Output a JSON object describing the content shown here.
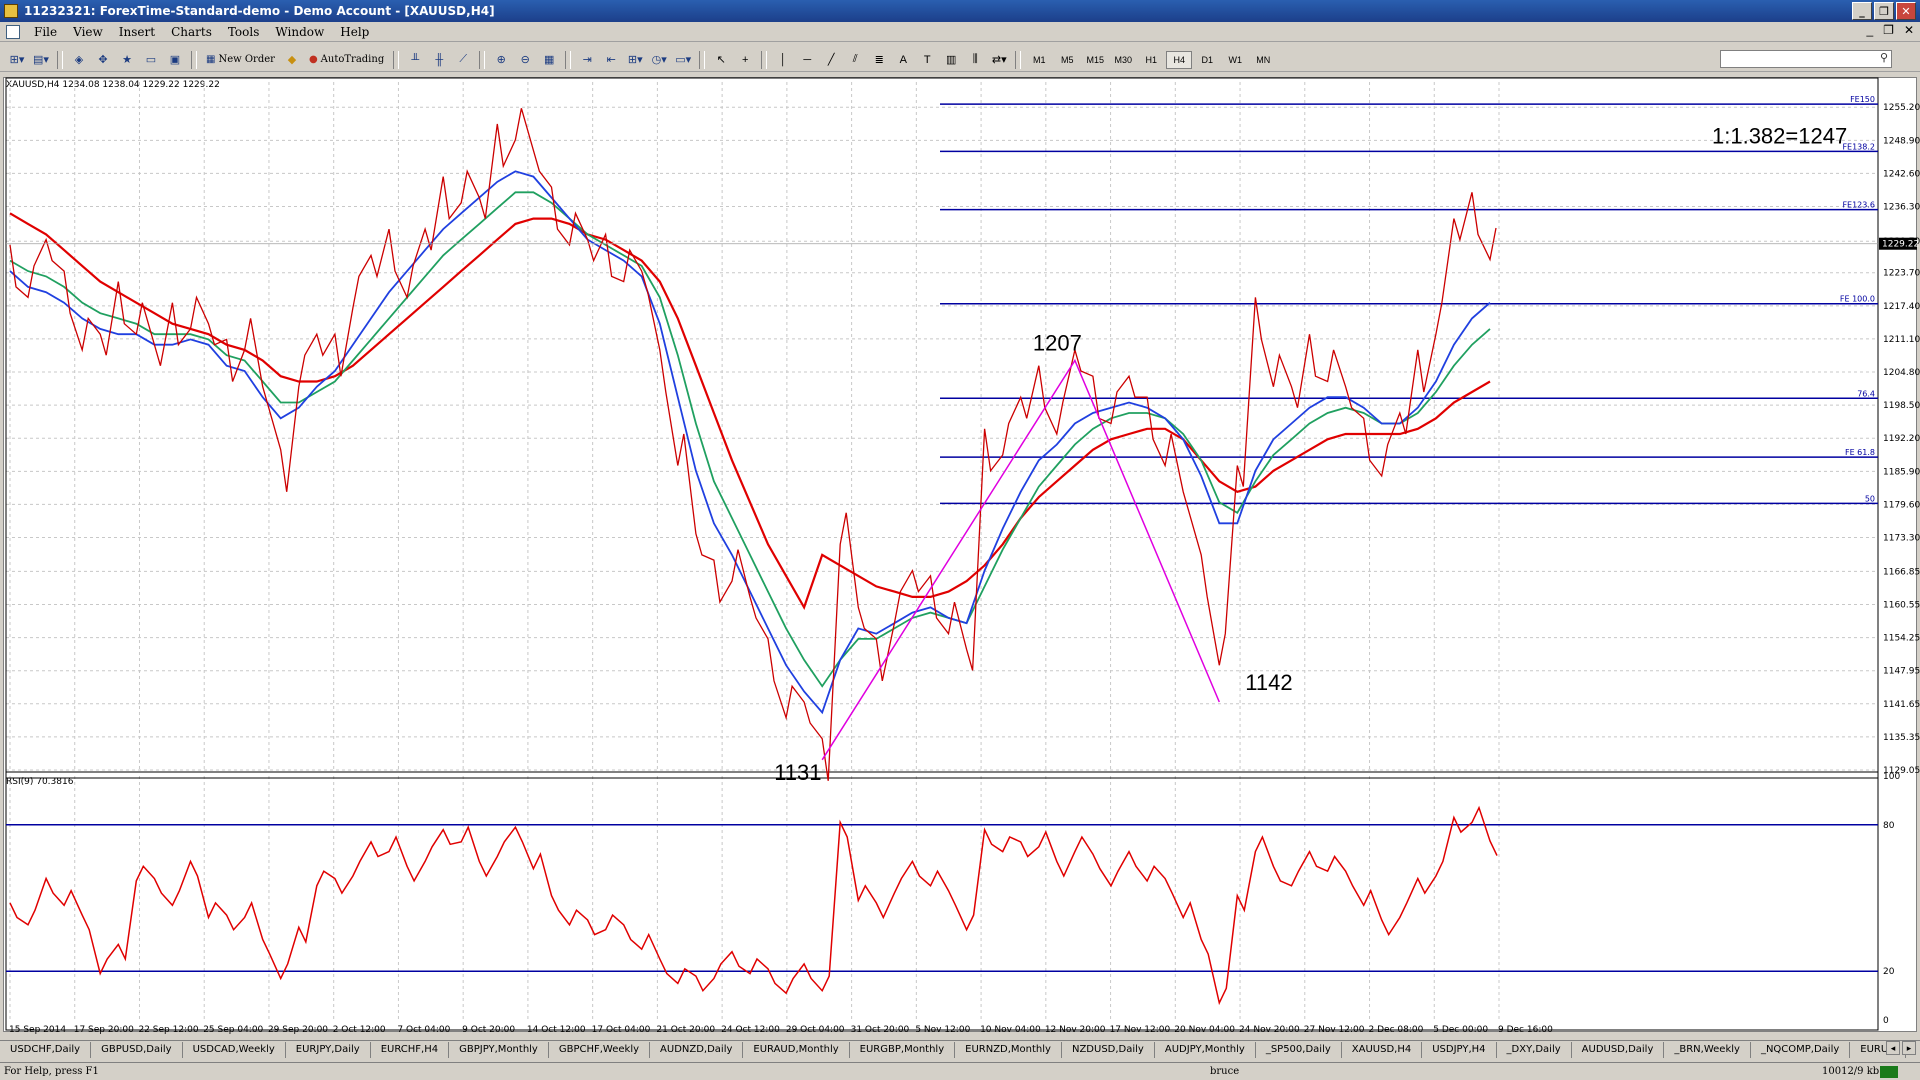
{
  "window": {
    "title": "11232321: ForexTime-Standard-demo - Demo Account - [XAUUSD,H4]",
    "controls": [
      "_",
      "❐",
      "✕"
    ]
  },
  "menu": {
    "items": [
      "File",
      "View",
      "Insert",
      "Charts",
      "Tools",
      "Window",
      "Help"
    ],
    "mdi_controls": [
      "_",
      "❐",
      "✕"
    ]
  },
  "toolbar": {
    "new_order_label": "New Order",
    "autotrading_label": "AutoTrading",
    "timeframes": [
      "M1",
      "M5",
      "M15",
      "M30",
      "H1",
      "H4",
      "D1",
      "W1",
      "MN"
    ],
    "active_timeframe": "H4",
    "search_placeholder": ""
  },
  "chart": {
    "header": "XAUUSD,H4  1234.08 1238.04 1229.22 1229.22",
    "rsi_header": "RSI(9) 70.3816",
    "current_price_label": "1229.22"
  },
  "chart_data": [
    {
      "type": "line",
      "title": "XAUUSD,H4  1234.08 1238.04 1229.22 1229.22",
      "x_ticks": [
        "15 Sep 2014",
        "17 Sep 20:00",
        "22 Sep 12:00",
        "25 Sep 04:00",
        "29 Sep 20:00",
        "2 Oct 12:00",
        "7 Oct 04:00",
        "9 Oct 20:00",
        "14 Oct 12:00",
        "17 Oct 04:00",
        "21 Oct 20:00",
        "24 Oct 12:00",
        "29 Oct 04:00",
        "31 Oct 20:00",
        "5 Nov 12:00",
        "10 Nov 04:00",
        "12 Nov 20:00",
        "17 Nov 12:00",
        "20 Nov 04:00",
        "24 Nov 20:00",
        "27 Nov 12:00",
        "2 Dec 08:00",
        "5 Dec 00:00",
        "9 Dec 16:00"
      ],
      "y_ticks": [
        "1255.20",
        "1248.90",
        "1242.60",
        "1236.30",
        "1229.70",
        "1223.70",
        "1217.40",
        "1211.10",
        "1204.80",
        "1198.50",
        "1192.20",
        "1185.90",
        "1179.60",
        "1173.30",
        "1166.85",
        "1160.55",
        "1154.25",
        "1147.95",
        "1141.65",
        "1135.35",
        "1129.05"
      ],
      "ylim": [
        1129.05,
        1260
      ],
      "price_path": [
        1225,
        1222,
        1228,
        1220,
        1212,
        1210,
        1218,
        1215,
        1208,
        1214,
        1216,
        1212,
        1207,
        1212,
        1200,
        1186,
        1205,
        1210,
        1208,
        1220,
        1225,
        1228,
        1222,
        1230,
        1238,
        1240,
        1236,
        1248,
        1252,
        1245,
        1236,
        1232,
        1228,
        1227,
        1225,
        1222,
        1205,
        1190,
        1172,
        1165,
        1168,
        1160,
        1150,
        1142,
        1140,
        1131,
        1175,
        1158,
        1150,
        1160,
        1165,
        1162,
        1158,
        1150,
        1190,
        1192,
        1198,
        1202,
        1196,
        1207,
        1200,
        1198,
        1202,
        1196,
        1190,
        1180,
        1166,
        1152,
        1185,
        1215,
        1205,
        1200,
        1208,
        1206,
        1200,
        1192,
        1188,
        1195,
        1205,
        1215,
        1232,
        1235,
        1229.22
      ],
      "ma_fast_path": [
        1224,
        1221,
        1220,
        1218,
        1215,
        1213,
        1212,
        1212,
        1210,
        1210,
        1211,
        1210,
        1206,
        1205,
        1200,
        1196,
        1198,
        1202,
        1205,
        1210,
        1215,
        1220,
        1224,
        1228,
        1232,
        1235,
        1238,
        1241,
        1243,
        1242,
        1238,
        1234,
        1230,
        1228,
        1226,
        1223,
        1214,
        1200,
        1186,
        1176,
        1170,
        1163,
        1156,
        1149,
        1144,
        1140,
        1150,
        1156,
        1155,
        1157,
        1159,
        1160,
        1158,
        1157,
        1167,
        1175,
        1182,
        1188,
        1191,
        1195,
        1197,
        1198,
        1199,
        1198,
        1196,
        1192,
        1185,
        1176,
        1176,
        1186,
        1192,
        1195,
        1198,
        1200,
        1200,
        1198,
        1195,
        1195,
        1198,
        1203,
        1210,
        1215,
        1218
      ],
      "ma_mid_path": [
        1226,
        1224,
        1223,
        1221,
        1218,
        1216,
        1215,
        1214,
        1212,
        1212,
        1212,
        1211,
        1208,
        1207,
        1203,
        1199,
        1199,
        1201,
        1203,
        1207,
        1211,
        1215,
        1219,
        1223,
        1227,
        1230,
        1233,
        1236,
        1239,
        1239,
        1237,
        1234,
        1231,
        1229,
        1227,
        1225,
        1219,
        1208,
        1195,
        1184,
        1177,
        1170,
        1163,
        1156,
        1150,
        1145,
        1150,
        1154,
        1154,
        1156,
        1158,
        1159,
        1158,
        1157,
        1164,
        1171,
        1177,
        1183,
        1187,
        1191,
        1194,
        1196,
        1197,
        1197,
        1196,
        1193,
        1188,
        1180,
        1178,
        1184,
        1189,
        1192,
        1195,
        1197,
        1198,
        1197,
        1195,
        1195,
        1197,
        1201,
        1206,
        1210,
        1213
      ],
      "ma_slow_path": [
        1235,
        1233,
        1231,
        1228,
        1225,
        1222,
        1220,
        1218,
        1216,
        1214,
        1213,
        1212,
        1210,
        1209,
        1207,
        1204,
        1203,
        1203,
        1204,
        1206,
        1209,
        1212,
        1215,
        1218,
        1221,
        1224,
        1227,
        1230,
        1233,
        1234,
        1234,
        1233,
        1231,
        1230,
        1228,
        1226,
        1222,
        1215,
        1206,
        1197,
        1188,
        1180,
        1172,
        1166,
        1160,
        1170,
        1168,
        1166,
        1164,
        1163,
        1162,
        1162,
        1163,
        1165,
        1168,
        1172,
        1177,
        1181,
        1184,
        1187,
        1190,
        1192,
        1193,
        1194,
        1194,
        1192,
        1188,
        1184,
        1182,
        1183,
        1186,
        1188,
        1190,
        1192,
        1193,
        1193,
        1193,
        1193,
        1194,
        1196,
        1199,
        1201,
        1203
      ],
      "fibo_levels": [
        {
          "label": "FE150",
          "value": 1255.8
        },
        {
          "label": "FE138.2",
          "value": 1246.8
        },
        {
          "label": "FE123.6",
          "value": 1235.7
        },
        {
          "label": "FE 100.0",
          "value": 1217.8
        },
        {
          "label": "76.4",
          "value": 1199.8
        },
        {
          "label": "FE 61.8",
          "value": 1188.6
        },
        {
          "label": "50",
          "value": 1179.8
        }
      ],
      "swing_points": [
        {
          "label": "1131",
          "value": 1131
        },
        {
          "label": "1207",
          "value": 1207
        },
        {
          "label": "1142",
          "value": 1142
        }
      ],
      "projection_annotation": "1:1.382=1247",
      "colors": {
        "price": "#cc0000",
        "ma_fast": "#2040e0",
        "ma_mid": "#20a060",
        "ma_slow": "#e00000",
        "fibo": "#0000a0",
        "swing": "#e000e0"
      }
    },
    {
      "type": "line",
      "title": "RSI(9) 70.3816",
      "y_ticks": [
        "100",
        "80",
        "20",
        "0"
      ],
      "ylim": [
        0,
        100
      ],
      "levels": [
        80,
        20
      ],
      "values": [
        45,
        42,
        55,
        50,
        40,
        22,
        28,
        60,
        55,
        50,
        62,
        45,
        40,
        45,
        30,
        20,
        35,
        58,
        55,
        62,
        70,
        72,
        60,
        68,
        75,
        76,
        62,
        70,
        76,
        65,
        48,
        42,
        38,
        40,
        36,
        32,
        22,
        18,
        15,
        20,
        25,
        22,
        18,
        14,
        20,
        15,
        78,
        52,
        45,
        55,
        62,
        58,
        50,
        40,
        75,
        72,
        70,
        74,
        62,
        72,
        65,
        58,
        66,
        60,
        55,
        45,
        30,
        10,
        48,
        72,
        60,
        58,
        66,
        64,
        58,
        50,
        38,
        45,
        55,
        62,
        80,
        84,
        70.38
      ],
      "colors": {
        "line": "#e00000",
        "levels": "#0000a0"
      }
    }
  ],
  "tabs": [
    "USDCHF,Daily",
    "GBPUSD,Daily",
    "USDCAD,Weekly",
    "EURJPY,Daily",
    "EURCHF,H4",
    "GBPJPY,Monthly",
    "GBPCHF,Weekly",
    "AUDNZD,Daily",
    "EURAUD,Monthly",
    "EURGBP,Monthly",
    "EURNZD,Monthly",
    "NZDUSD,Daily",
    "AUDJPY,Monthly",
    "_SP500,Daily",
    "XAUUSD,H4",
    "USDJPY,H4",
    "_DXY,Daily",
    "AUDUSD,Daily",
    "_BRN,Weekly",
    "_NQCOMP,Daily",
    "EURUS"
  ],
  "status": {
    "help": "For Help, press F1",
    "profile": "bruce",
    "connection": "10012/9 kb"
  }
}
